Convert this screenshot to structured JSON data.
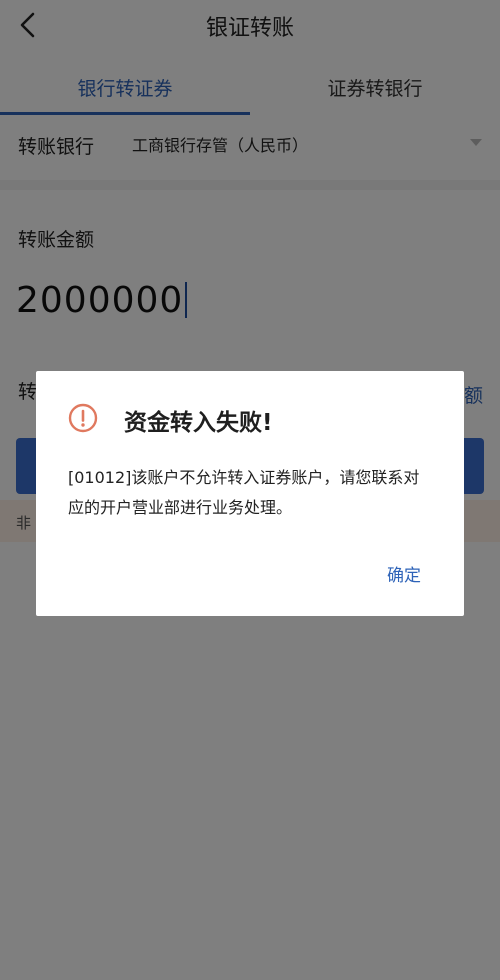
{
  "header": {
    "title": "银证转账",
    "back_icon": "back-arrow-icon"
  },
  "tabs": [
    {
      "label": "银行转证券",
      "active": true
    },
    {
      "label": "证券转银行",
      "active": false
    }
  ],
  "form": {
    "bank_label": "转账银行",
    "bank_value": "工商银行存管（人民币）",
    "amount_label": "转账金额",
    "amount_value": "2000000",
    "partial_left_label": "转",
    "partial_right_label": "额",
    "partial_bottom_label": "非"
  },
  "dialog": {
    "icon": "exclamation-circle-icon",
    "title": "资金转入失败!",
    "message": "[01012]该账户不允许转入证券账户，请您联系对应的开户营业部进行业务处理。",
    "ok_label": "确定"
  },
  "colors": {
    "accent": "#2e63b8",
    "warning": "#e0795f",
    "primary_button": "#3b6fd0"
  }
}
